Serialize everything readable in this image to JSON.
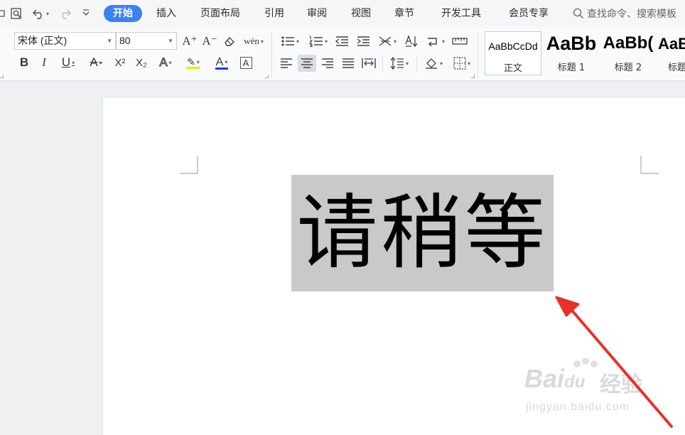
{
  "menu_tabs": [
    {
      "label": "开始",
      "active": true
    },
    {
      "label": "插入"
    },
    {
      "label": "页面布局"
    },
    {
      "label": "引用"
    },
    {
      "label": "审阅"
    },
    {
      "label": "视图"
    },
    {
      "label": "章节"
    },
    {
      "label": "开发工具"
    },
    {
      "label": "会员专享"
    }
  ],
  "search": {
    "placeholder": "查找命令、搜索模板"
  },
  "font": {
    "name": "宋体 (正文)",
    "size": "80"
  },
  "styles": [
    {
      "sample": "AaBbCcDd",
      "name": "正文"
    },
    {
      "sample": "AaBb",
      "name": "标题 1"
    },
    {
      "sample": "AaBb(",
      "name": "标题 2"
    },
    {
      "sample": "AaB",
      "name": "标题"
    }
  ],
  "document": {
    "text": "请稍等"
  },
  "watermark": {
    "brand": "Bai",
    "brand_mid": "du",
    "brand_cn": "经验",
    "site": "jingyan.baidu.com"
  },
  "icons": {
    "font_grow": "A⁺",
    "font_shrink": "A⁻",
    "clear_format": "◇",
    "pinyin": "wén",
    "bold": "B",
    "italic": "I",
    "underline": "U",
    "strike": "A",
    "superscript": "X²",
    "subscript": "X₂",
    "text_effect": "A",
    "highlight": "✎",
    "font_color": "A",
    "char_border": "A"
  },
  "colors": {
    "accent": "#3a82f0",
    "highlight": "#f5e600",
    "font_color": "#1c3fd6",
    "arrow": "#e8302b"
  }
}
